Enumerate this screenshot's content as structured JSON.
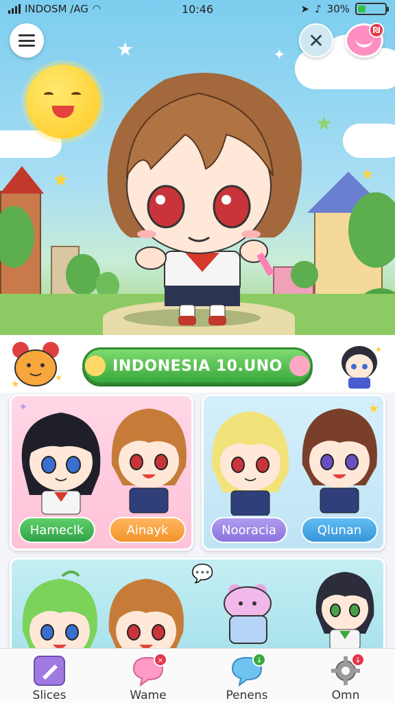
{
  "status_bar": {
    "carrier": "INDOSM /AG",
    "time": "10:46",
    "battery": "30%",
    "battery_level": 0.3
  },
  "banner": {
    "title": "INDONESIA 10.UNO"
  },
  "cards": [
    {
      "buttons": [
        "Hameclk",
        "Ainayk"
      ]
    },
    {
      "buttons": [
        "Nooracia",
        "Qlunan"
      ]
    }
  ],
  "bottom_nav": [
    {
      "label": "Slices",
      "icon": "slices-icon"
    },
    {
      "label": "Wame",
      "icon": "chat-bubble-icon"
    },
    {
      "label": "Penens",
      "icon": "message-icon"
    },
    {
      "label": "Omn",
      "icon": "gear-icon"
    }
  ],
  "colors": {
    "accent_green": "#3aa83c",
    "badge_red": "#e5364a",
    "card_pink": "#ffc2d8",
    "card_blue": "#bfe4f5"
  }
}
